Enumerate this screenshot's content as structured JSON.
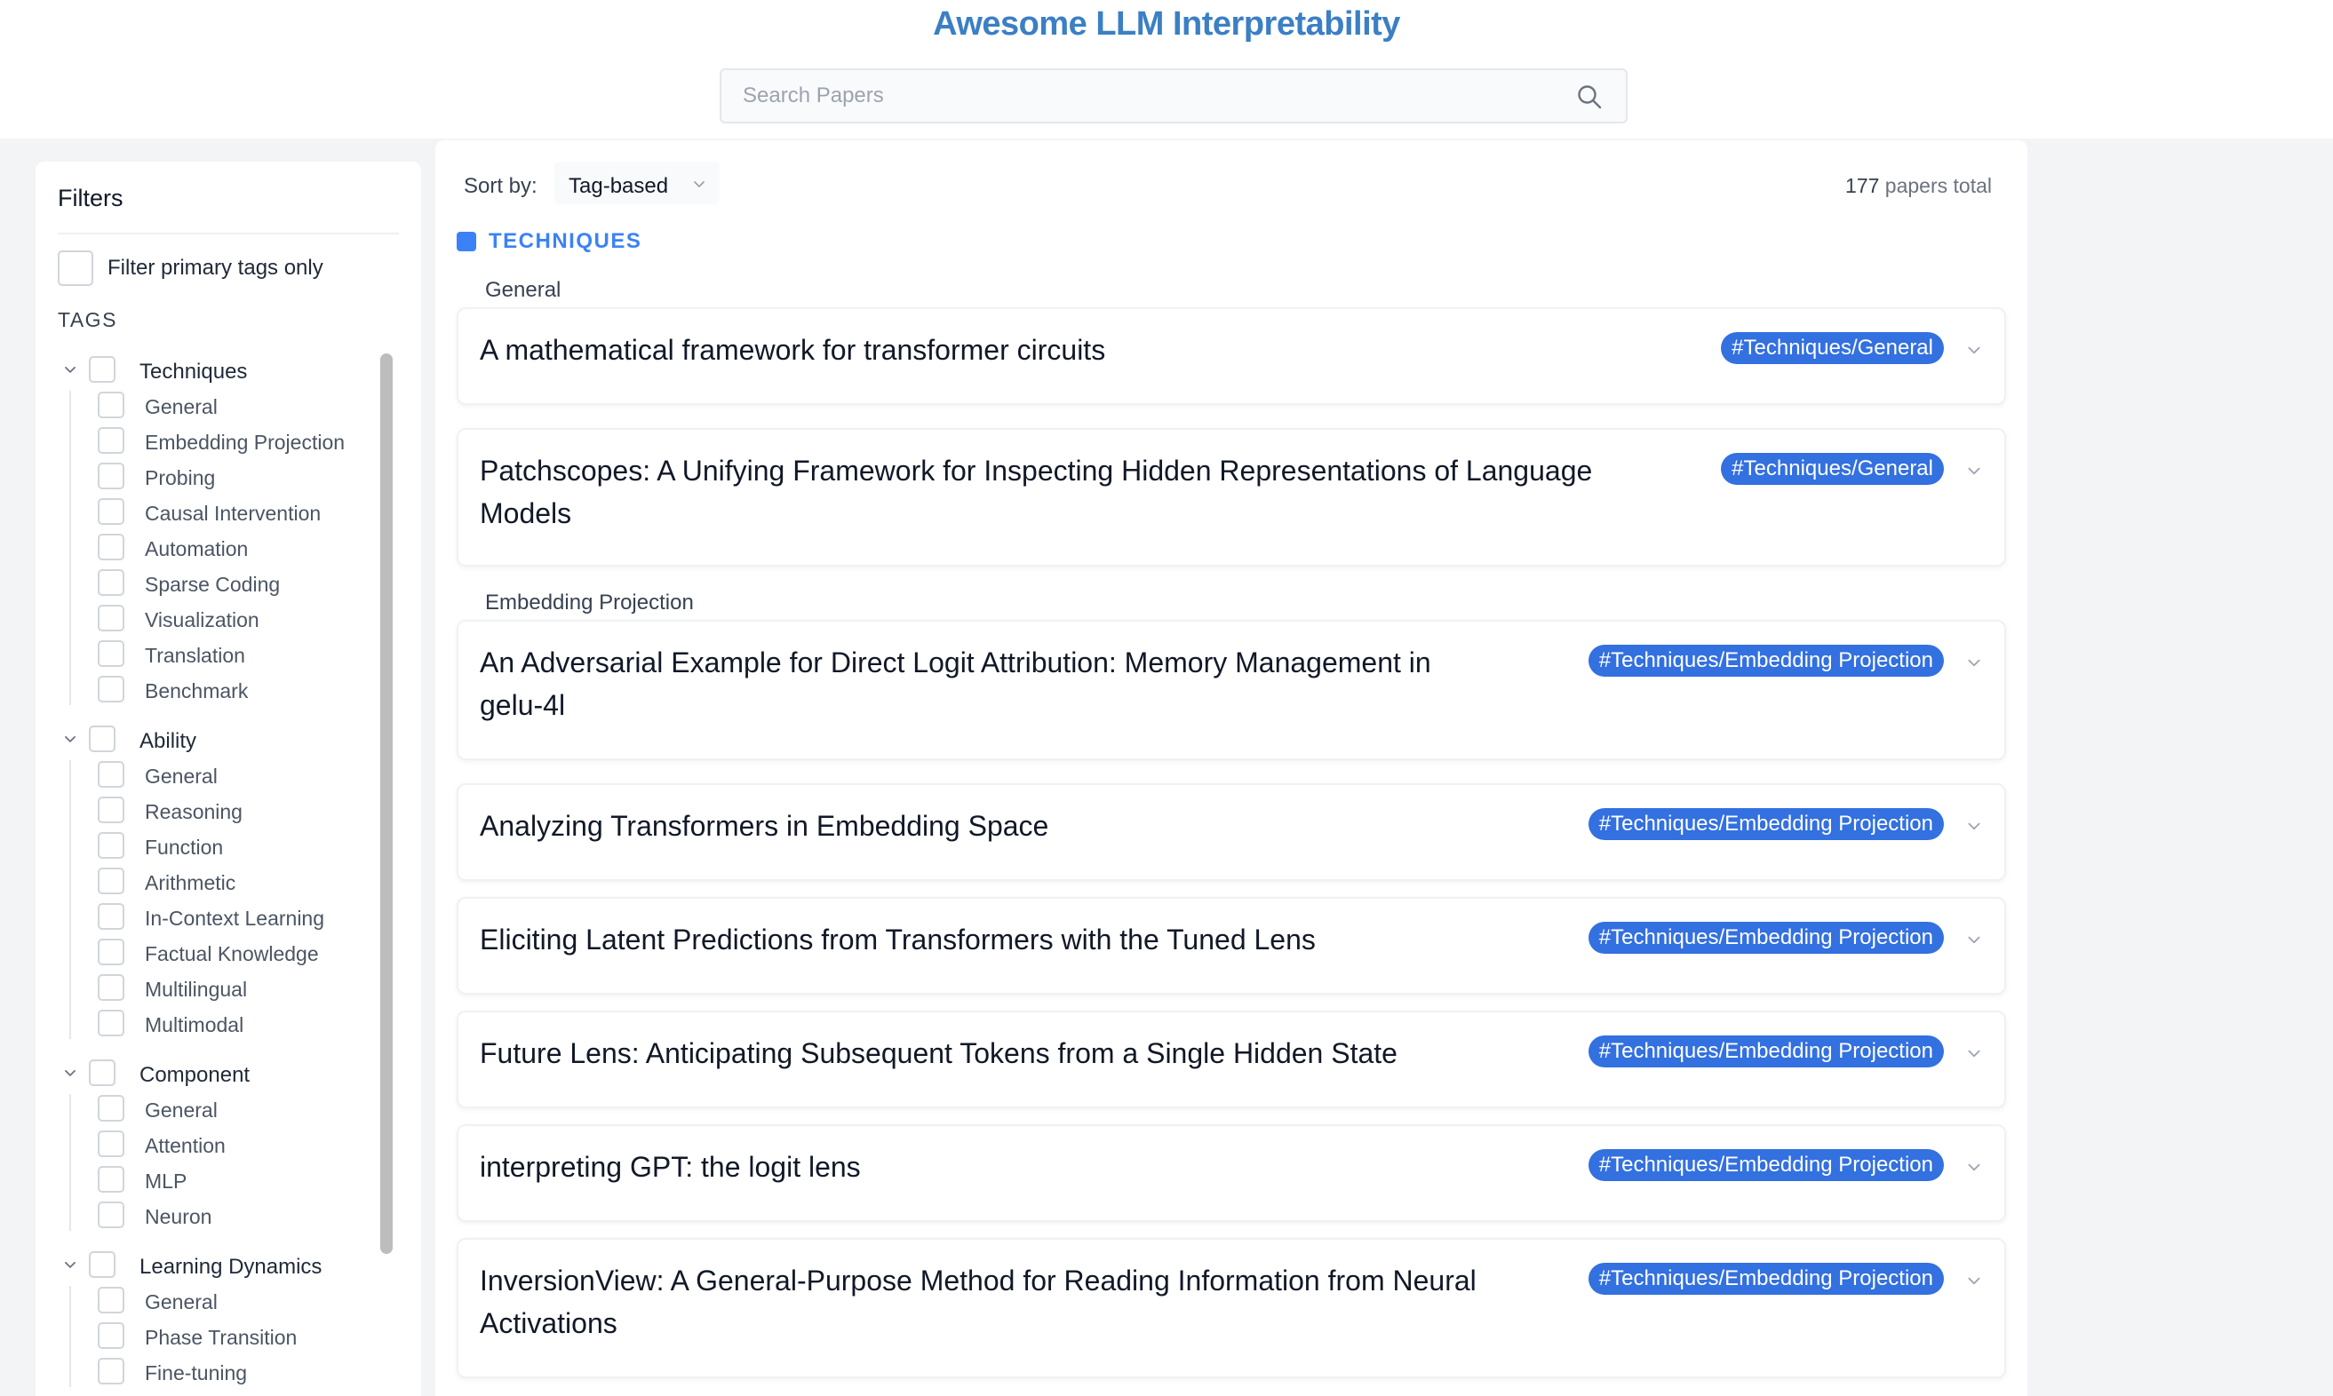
{
  "header": {
    "title": "Awesome LLM Interpretability",
    "search_placeholder": "Search Papers",
    "search_icon": "search-icon"
  },
  "sidebar": {
    "title": "Filters",
    "primary_only_label": "Filter primary tags only",
    "tags_heading": "TAGS",
    "groups": [
      {
        "label": "Techniques",
        "items": [
          "General",
          "Embedding Projection",
          "Probing",
          "Causal Intervention",
          "Automation",
          "Sparse Coding",
          "Visualization",
          "Translation",
          "Benchmark"
        ]
      },
      {
        "label": "Ability",
        "items": [
          "General",
          "Reasoning",
          "Function",
          "Arithmetic",
          "In-Context Learning",
          "Factual Knowledge",
          "Multilingual",
          "Multimodal"
        ]
      },
      {
        "label": "Component",
        "items": [
          "General",
          "Attention",
          "MLP",
          "Neuron"
        ]
      },
      {
        "label": "Learning Dynamics",
        "items": [
          "General",
          "Phase Transition",
          "Fine-tuning"
        ]
      }
    ]
  },
  "main": {
    "sort_label": "Sort by:",
    "sort_value": "Tag-based",
    "total_count": "177",
    "total_suffix": "papers total",
    "section_title": "TECHNIQUES",
    "section_color": "#3b82f6",
    "badge_color": "#3370e0",
    "subsections": [
      {
        "label": "General",
        "papers": [
          {
            "title": "A mathematical framework for transformer circuits",
            "tag": "#Techniques/General"
          },
          {
            "title": "Patchscopes: A Unifying Framework for Inspecting Hidden Representations of Language Models",
            "tag": "#Techniques/General"
          }
        ]
      },
      {
        "label": "Embedding Projection",
        "papers": [
          {
            "title": "An Adversarial Example for Direct Logit Attribution: Memory Management in gelu-4l",
            "tag": "#Techniques/Embedding Projection"
          },
          {
            "title": "Analyzing Transformers in Embedding Space",
            "tag": "#Techniques/Embedding Projection"
          },
          {
            "title": "Eliciting Latent Predictions from Transformers with the Tuned Lens",
            "tag": "#Techniques/Embedding Projection"
          },
          {
            "title": "Future Lens: Anticipating Subsequent Tokens from a Single Hidden State",
            "tag": "#Techniques/Embedding Projection"
          },
          {
            "title": "interpreting GPT: the logit lens",
            "tag": "#Techniques/Embedding Projection"
          },
          {
            "title": "InversionView: A General-Purpose Method for Reading Information from Neural Activations",
            "tag": "#Techniques/Embedding Projection"
          }
        ]
      }
    ]
  }
}
